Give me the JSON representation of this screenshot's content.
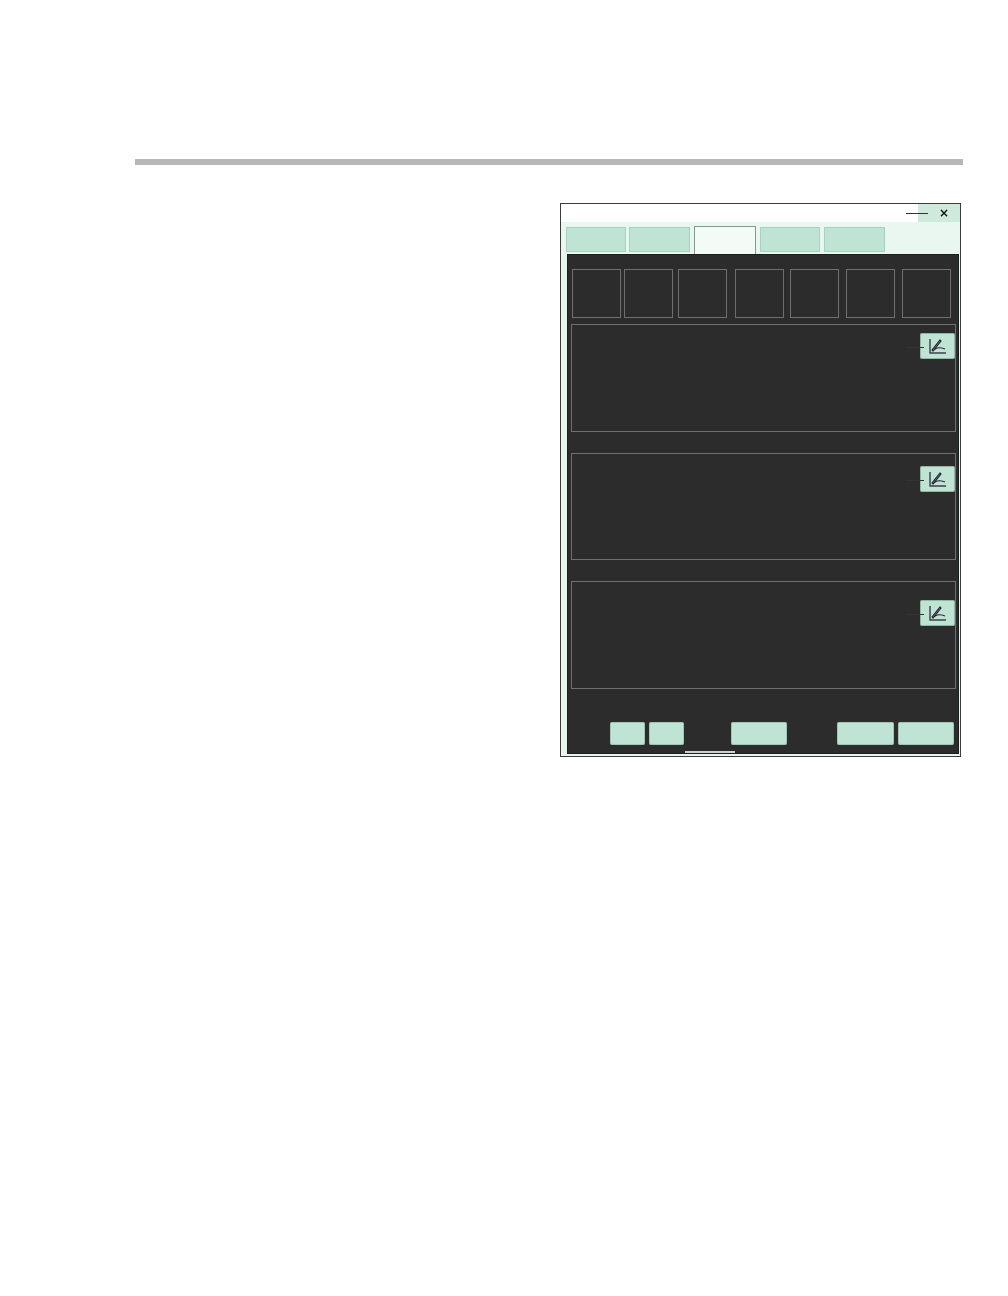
{
  "window": {
    "title": "",
    "close_label": "×",
    "tabs": [
      {
        "label": ""
      },
      {
        "label": ""
      },
      {
        "label": "",
        "active": true
      },
      {
        "label": ""
      },
      {
        "label": ""
      }
    ],
    "value_cells": [
      "",
      "",
      "",
      "",
      "",
      "",
      ""
    ],
    "sections": [
      {
        "name": "section-1",
        "edit_icon": "edit-chart-icon"
      },
      {
        "name": "section-2",
        "edit_icon": "edit-chart-icon"
      },
      {
        "name": "section-3",
        "edit_icon": "edit-chart-icon"
      }
    ],
    "bottom_buttons": [
      {
        "label": ""
      },
      {
        "label": ""
      },
      {
        "label": ""
      },
      {
        "label": ""
      },
      {
        "label": ""
      }
    ]
  },
  "colors": {
    "panel": "#2c2c2c",
    "button": "#bfe4d3",
    "tab_active": "#f3fbf7"
  }
}
